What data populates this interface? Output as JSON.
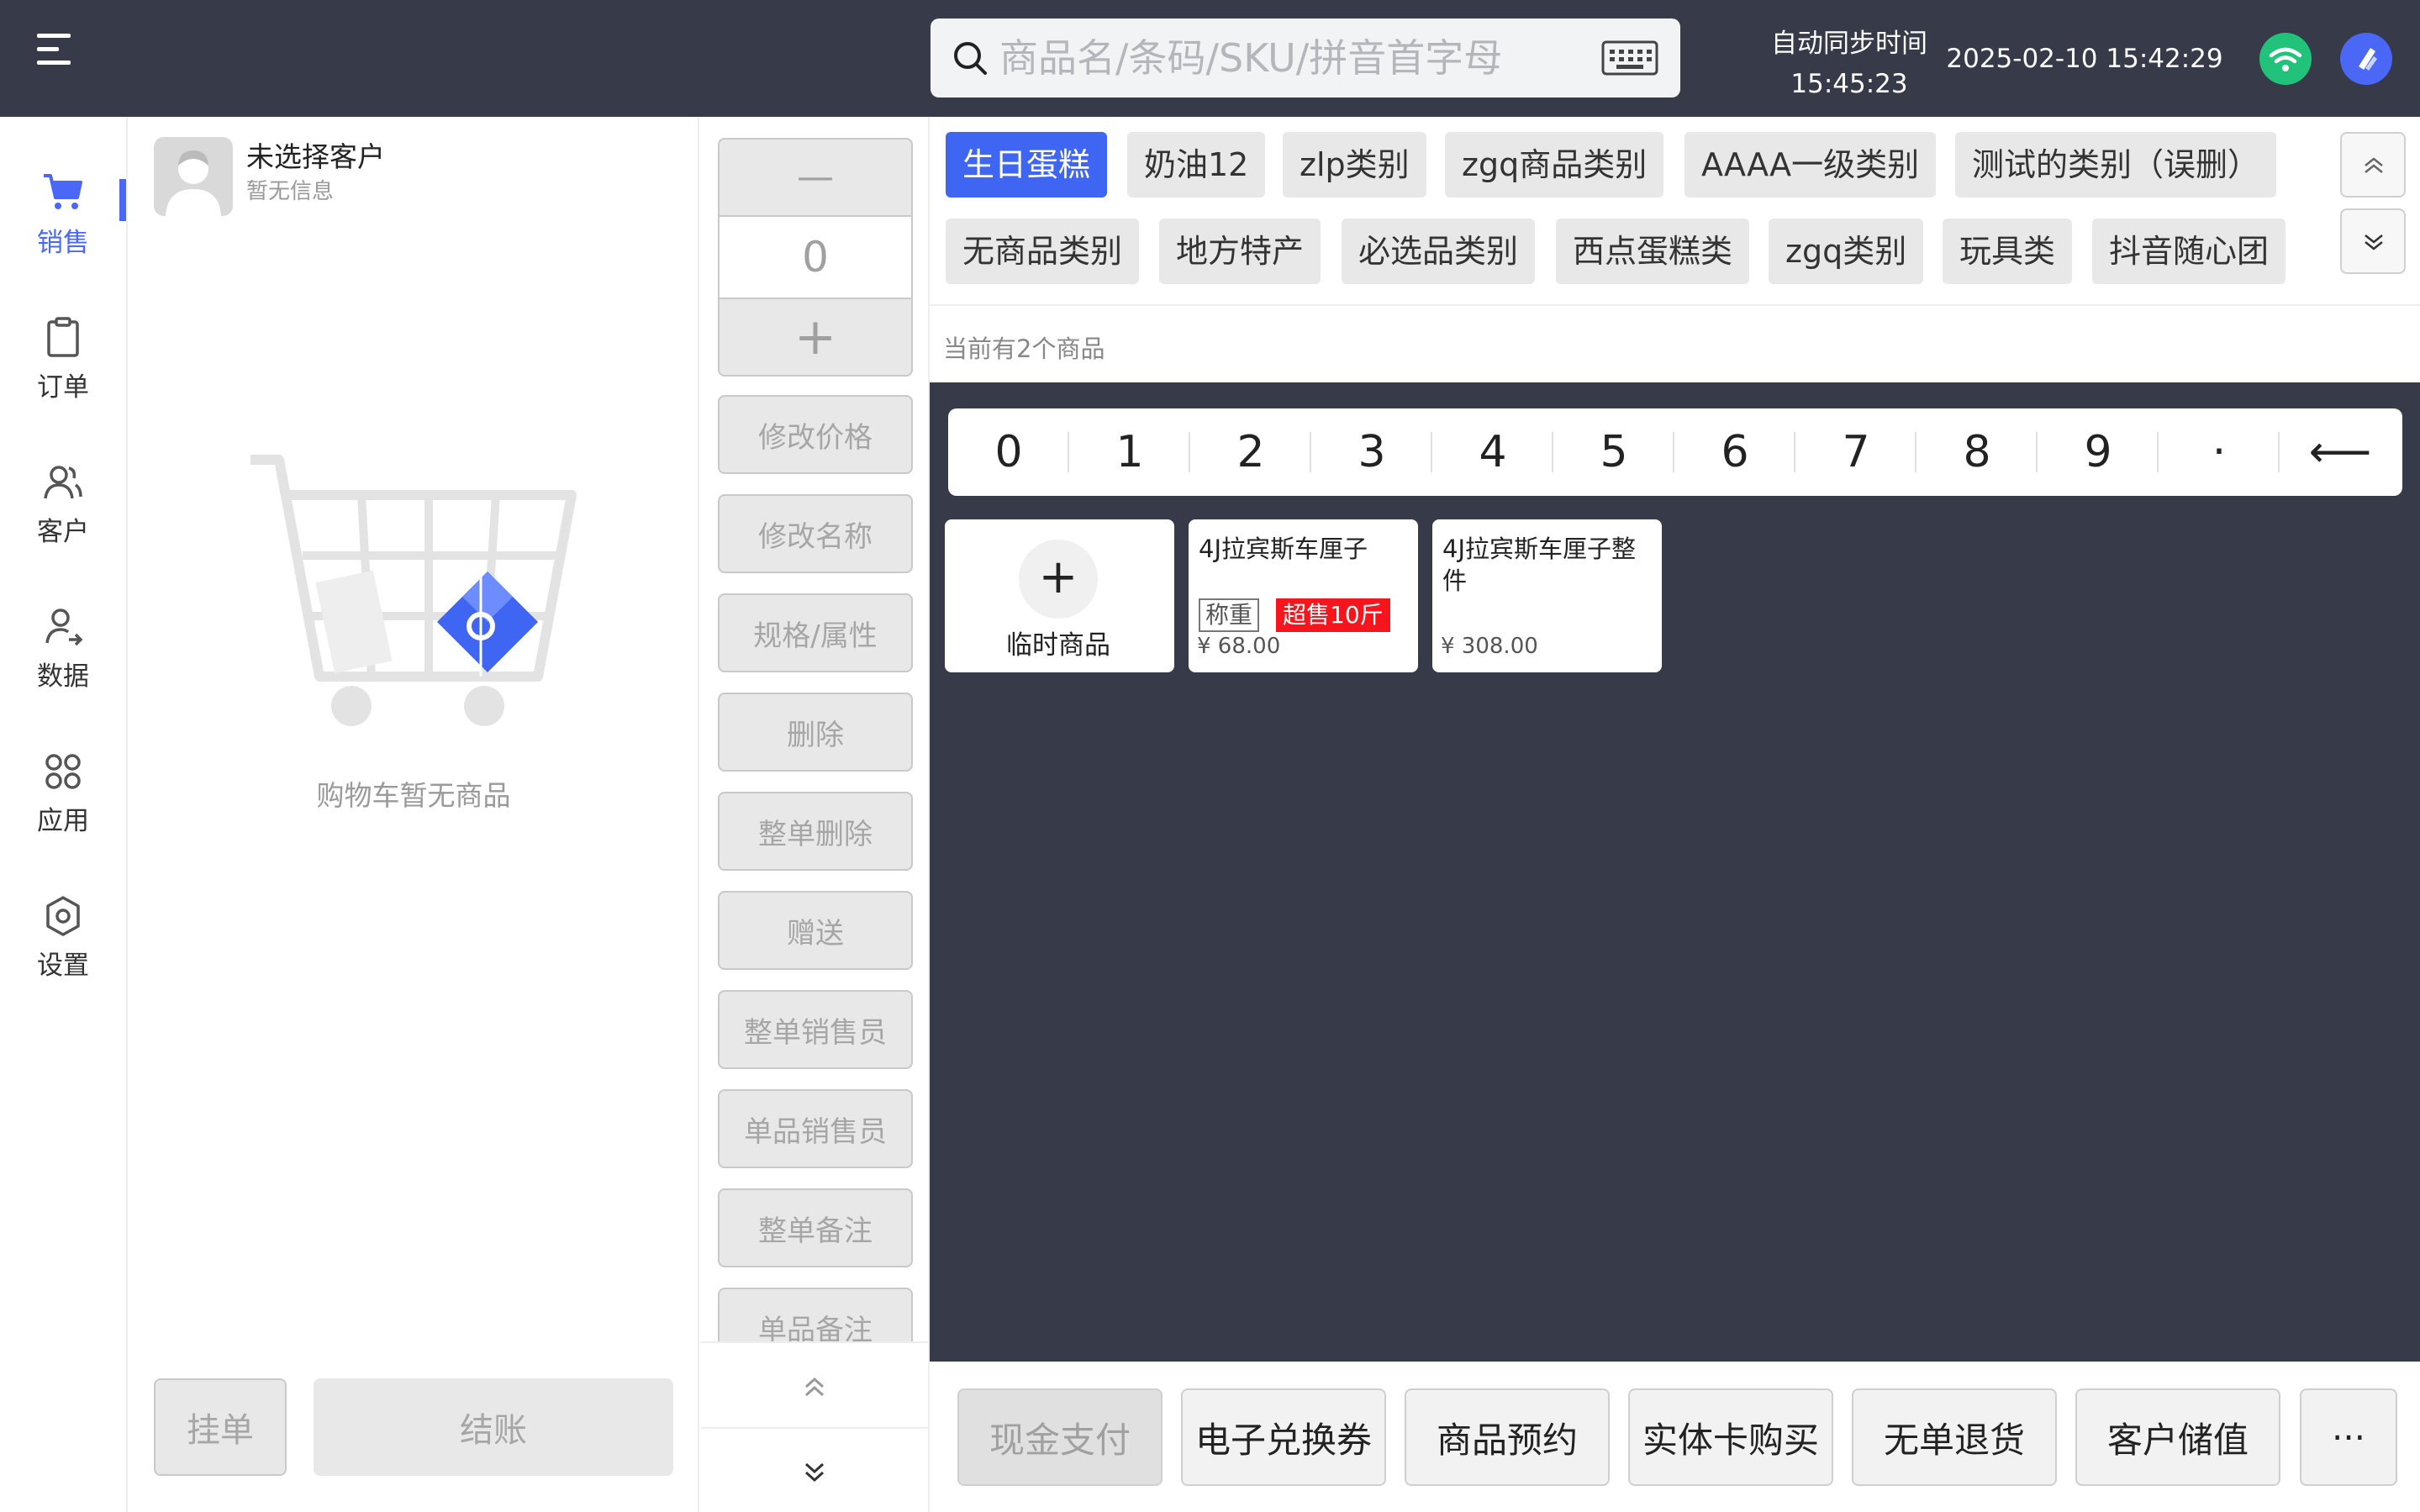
{
  "header": {
    "search_placeholder": "商品名/条码/SKU/拼音首字母",
    "sync_label": "自动同步时间",
    "sync_time": "15:45:23",
    "current_time": "2025-02-10 15:42:29"
  },
  "nav": {
    "items": [
      {
        "label": "销售",
        "icon": "cart-icon",
        "active": true
      },
      {
        "label": "订单",
        "icon": "clipboard-icon"
      },
      {
        "label": "客户",
        "icon": "users-icon"
      },
      {
        "label": "数据",
        "icon": "user-chart-icon"
      },
      {
        "label": "应用",
        "icon": "apps-grid-icon"
      },
      {
        "label": "设置",
        "icon": "gear-icon"
      }
    ]
  },
  "cart": {
    "customer_name": "未选择客户",
    "customer_info": "暂无信息",
    "empty_text": "购物车暂无商品",
    "hold_label": "挂单",
    "checkout_label": "结账"
  },
  "actions": {
    "minus": "—",
    "plus": "+",
    "quantity": "0",
    "buttons": [
      "修改价格",
      "修改名称",
      "规格/属性",
      "删除",
      "整单删除",
      "赠送",
      "整单销售员",
      "单品销售员",
      "整单备注",
      "单品备注"
    ]
  },
  "categories": {
    "row1": [
      "生日蛋糕",
      "奶油12",
      "zlp类别",
      "zgq商品类别",
      "AAAA一级类别",
      "测试的类别（误删）"
    ],
    "row2": [
      "无商品类别",
      "地方特产",
      "必选品类别",
      "西点蛋糕类",
      "zgq类别",
      "玩具类",
      "抖音随心团"
    ]
  },
  "product_count_text": "当前有2个商品",
  "keypad": [
    "0",
    "1",
    "2",
    "3",
    "4",
    "5",
    "6",
    "7",
    "8",
    "9",
    "·",
    "⟵"
  ],
  "products": {
    "temp_label": "临时商品",
    "temp_plus": "+",
    "items": [
      {
        "name": "4J拉宾斯车厘子",
        "tag_weigh": "称重",
        "tag_oversell": "超售10斤",
        "price": "¥ 68.00"
      },
      {
        "name": "4J拉宾斯车厘子整件",
        "price": "¥ 308.00"
      }
    ]
  },
  "bottom_bar": {
    "buttons": [
      "现金支付",
      "电子兑换券",
      "商品预约",
      "实体卡购买",
      "无单退货",
      "客户储值"
    ],
    "more": "···"
  },
  "colors": {
    "header_bg": "#373a48",
    "accent": "#3f66f2",
    "wifi": "#21c27a",
    "oversell_red": "#f5151c"
  }
}
